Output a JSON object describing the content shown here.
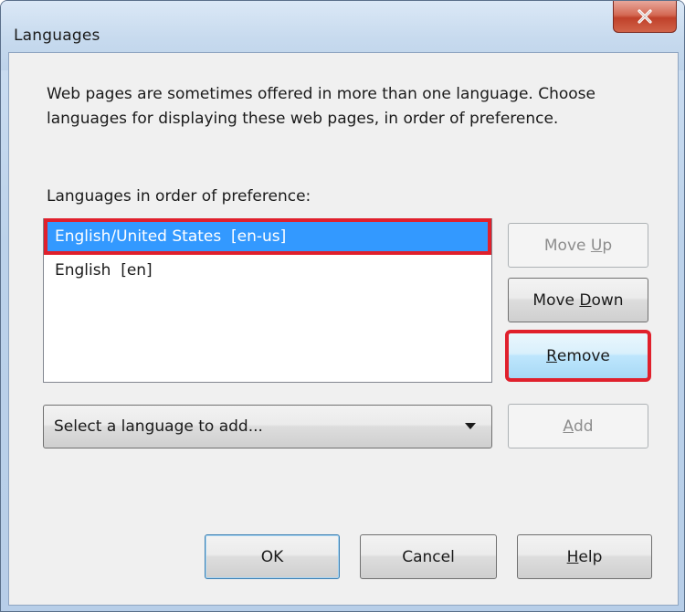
{
  "window": {
    "title": "Languages",
    "close_label": "X"
  },
  "description": "Web pages are sometimes offered in more than one language. Choose languages for displaying these web pages, in order of preference.",
  "list": {
    "label": "Languages in order of preference:",
    "items": [
      {
        "label": "English/United States  [en-us]",
        "selected": true
      },
      {
        "label": "English  [en]",
        "selected": false
      }
    ]
  },
  "side_buttons": {
    "move_up": {
      "before": "Move ",
      "mnemonic": "U",
      "after": "p",
      "enabled": false
    },
    "move_down": {
      "before": "Move ",
      "mnemonic": "D",
      "after": "own",
      "enabled": true
    },
    "remove": {
      "before": "",
      "mnemonic": "R",
      "after": "emove",
      "enabled": true,
      "highlighted": true
    }
  },
  "add_row": {
    "select_value": "Select a language to add...",
    "add_button": {
      "before": "",
      "mnemonic": "A",
      "after": "dd",
      "enabled": false
    }
  },
  "footer": {
    "ok_label": "OK",
    "cancel_label": "Cancel",
    "help": {
      "before": "",
      "mnemonic": "H",
      "after": "elp"
    }
  },
  "colors": {
    "selection": "#3399ff",
    "annotation_highlight": "#e0202c",
    "close_button": "#c7432c"
  },
  "icons": {
    "close": "close-icon",
    "dropdown": "chevron-down-icon"
  }
}
